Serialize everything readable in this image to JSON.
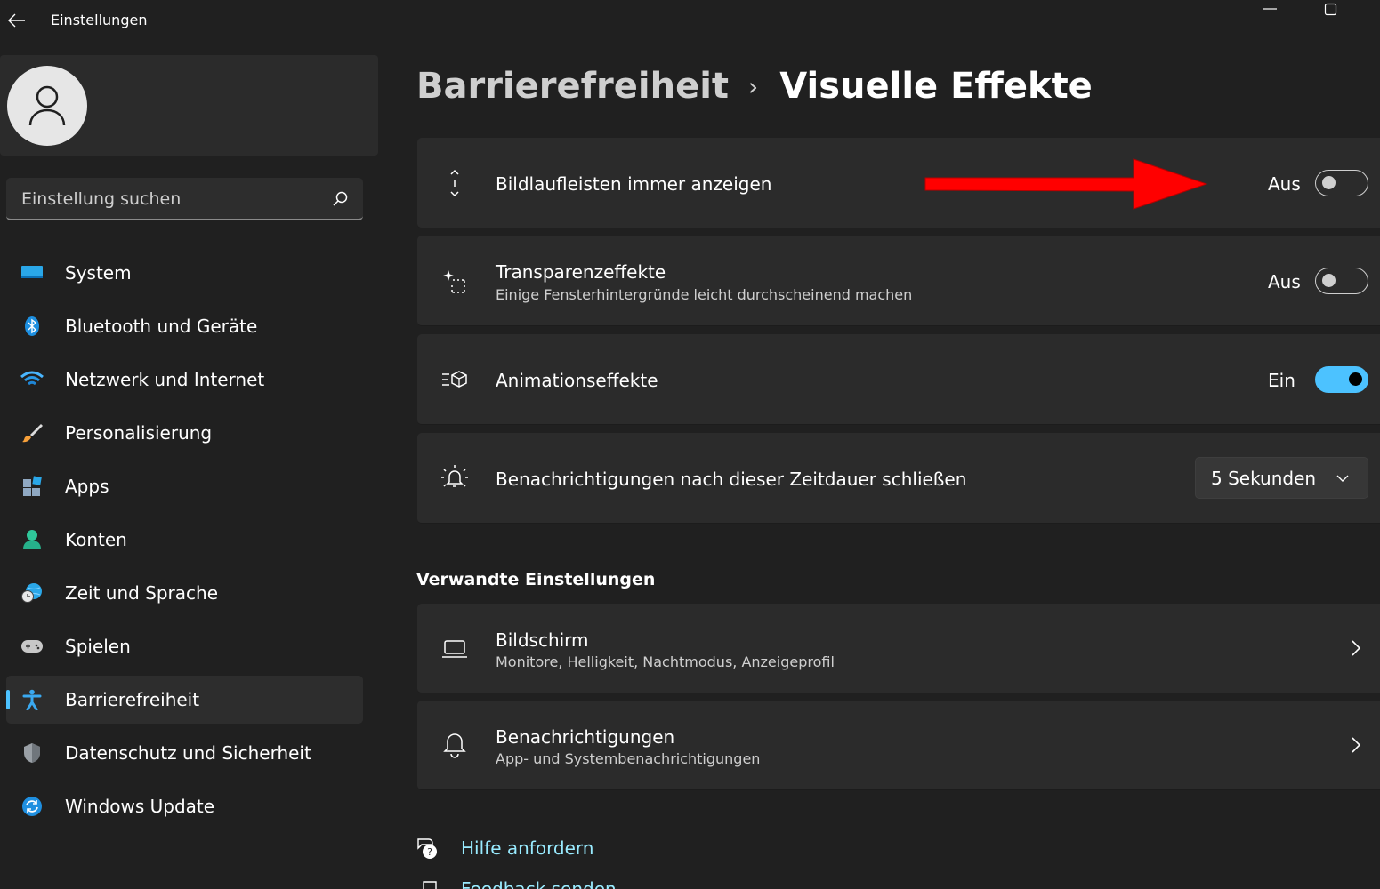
{
  "window": {
    "title": "Einstellungen"
  },
  "search": {
    "placeholder": "Einstellung suchen"
  },
  "sidebar": {
    "items": [
      {
        "label": "System",
        "icon": "system-icon"
      },
      {
        "label": "Bluetooth und Geräte",
        "icon": "bluetooth-icon"
      },
      {
        "label": "Netzwerk und Internet",
        "icon": "wifi-icon"
      },
      {
        "label": "Personalisierung",
        "icon": "brush-icon"
      },
      {
        "label": "Apps",
        "icon": "apps-icon"
      },
      {
        "label": "Konten",
        "icon": "account-icon"
      },
      {
        "label": "Zeit und Sprache",
        "icon": "globe-clock-icon"
      },
      {
        "label": "Spielen",
        "icon": "gamepad-icon"
      },
      {
        "label": "Barrierefreiheit",
        "icon": "accessibility-icon",
        "active": true
      },
      {
        "label": "Datenschutz und Sicherheit",
        "icon": "shield-icon"
      },
      {
        "label": "Windows Update",
        "icon": "update-icon"
      }
    ]
  },
  "breadcrumb": {
    "parent": "Barrierefreiheit",
    "separator": "›",
    "current": "Visuelle Effekte"
  },
  "settings": [
    {
      "title": "Bildlaufleisten immer anzeigen",
      "state_label": "Aus",
      "on": false,
      "icon": "scrollbar-icon"
    },
    {
      "title": "Transparenzeffekte",
      "subtitle": "Einige Fensterhintergründe leicht durchscheinend machen",
      "state_label": "Aus",
      "on": false,
      "icon": "transparency-icon"
    },
    {
      "title": "Animationseffekte",
      "state_label": "Ein",
      "on": true,
      "icon": "animation-icon"
    },
    {
      "title": "Benachrichtigungen nach dieser Zeitdauer schließen",
      "dropdown_value": "5 Sekunden",
      "icon": "notification-duration-icon"
    }
  ],
  "related": {
    "title": "Verwandte Einstellungen",
    "items": [
      {
        "title": "Bildschirm",
        "subtitle": "Monitore, Helligkeit, Nachtmodus, Anzeigeprofil",
        "icon": "laptop-icon"
      },
      {
        "title": "Benachrichtigungen",
        "subtitle": "App- und Systembenachrichtigungen",
        "icon": "bell-icon"
      }
    ]
  },
  "footer": {
    "help": "Hilfe anfordern",
    "feedback": "Feedback senden"
  },
  "colors": {
    "accent": "#4cc2ff",
    "background": "#202020",
    "card": "#2b2b2b",
    "annotation_arrow": "#ff0000"
  }
}
